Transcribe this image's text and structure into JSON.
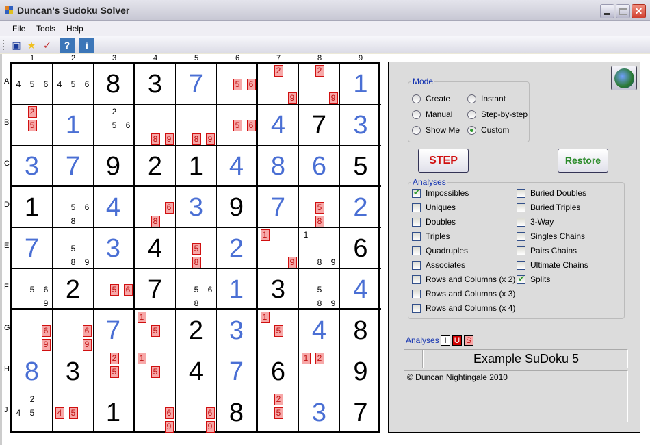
{
  "window": {
    "title": "Duncan's Sudoku Solver",
    "controls": [
      "minimize",
      "maximize",
      "close"
    ]
  },
  "menu": [
    "File",
    "Tools",
    "Help"
  ],
  "toolbar": [
    {
      "name": "save-icon",
      "glyph": "💾"
    },
    {
      "name": "star-icon",
      "glyph": "★"
    },
    {
      "name": "check-document-icon",
      "glyph": "✔"
    },
    {
      "name": "help-icon",
      "glyph": "?"
    },
    {
      "name": "info-icon",
      "glyph": "i"
    }
  ],
  "grid": {
    "columns": [
      "1",
      "2",
      "3",
      "4",
      "5",
      "6",
      "7",
      "8",
      "9"
    ],
    "rows": [
      "A",
      "B",
      "C",
      "D",
      "E",
      "F",
      "G",
      "H",
      "J"
    ],
    "colors": {
      "given": "#000000",
      "solved": "#4a6fd4",
      "impossible_bg": "#f7a8a8",
      "impossible_border": "#d01010"
    },
    "cells": [
      [
        {
          "c": [
            [
              4,
              "n"
            ],
            [
              5,
              "n"
            ],
            [
              6,
              "n"
            ]
          ]
        },
        {
          "c": [
            [
              4,
              "n"
            ],
            [
              5,
              "n"
            ],
            [
              6,
              "n"
            ]
          ]
        },
        {
          "v": 8,
          "t": "k"
        },
        {
          "v": 3,
          "t": "k"
        },
        {
          "v": 7,
          "t": "b"
        },
        {
          "c": [
            [
              5,
              "r"
            ],
            [
              6,
              "r"
            ]
          ]
        },
        {
          "c": [
            [
              2,
              "r"
            ],
            [
              9,
              "r"
            ]
          ]
        },
        {
          "c": [
            [
              2,
              "r"
            ],
            [
              9,
              "r"
            ]
          ]
        },
        {
          "v": 1,
          "t": "b"
        }
      ],
      [
        {
          "c": [
            [
              2,
              "r"
            ],
            [
              5,
              "r"
            ]
          ]
        },
        {
          "v": 1,
          "t": "b"
        },
        {
          "c": [
            [
              2,
              "n"
            ],
            [
              5,
              "n"
            ],
            [
              6,
              "n"
            ]
          ]
        },
        {
          "c": [
            [
              8,
              "r"
            ],
            [
              9,
              "r"
            ]
          ]
        },
        {
          "c": [
            [
              8,
              "r"
            ],
            [
              9,
              "r"
            ]
          ]
        },
        {
          "c": [
            [
              5,
              "r"
            ],
            [
              6,
              "r"
            ]
          ]
        },
        {
          "v": 4,
          "t": "b"
        },
        {
          "v": 7,
          "t": "k"
        },
        {
          "v": 3,
          "t": "b"
        }
      ],
      [
        {
          "v": 3,
          "t": "b"
        },
        {
          "v": 7,
          "t": "b"
        },
        {
          "v": 9,
          "t": "k"
        },
        {
          "v": 2,
          "t": "k"
        },
        {
          "v": 1,
          "t": "k"
        },
        {
          "v": 4,
          "t": "b"
        },
        {
          "v": 8,
          "t": "b"
        },
        {
          "v": 6,
          "t": "b"
        },
        {
          "v": 5,
          "t": "k"
        }
      ],
      [
        {
          "v": 1,
          "t": "k"
        },
        {
          "c": [
            [
              5,
              "n"
            ],
            [
              6,
              "n"
            ],
            [
              8,
              "n"
            ]
          ]
        },
        {
          "v": 4,
          "t": "b"
        },
        {
          "c": [
            [
              6,
              "r"
            ],
            [
              8,
              "r"
            ]
          ]
        },
        {
          "v": 3,
          "t": "b"
        },
        {
          "v": 9,
          "t": "k"
        },
        {
          "v": 7,
          "t": "b"
        },
        {
          "c": [
            [
              5,
              "r"
            ],
            [
              8,
              "r"
            ]
          ]
        },
        {
          "v": 2,
          "t": "b"
        }
      ],
      [
        {
          "v": 7,
          "t": "b"
        },
        {
          "c": [
            [
              5,
              "n"
            ],
            [
              8,
              "n"
            ],
            [
              9,
              "n"
            ]
          ]
        },
        {
          "v": 3,
          "t": "b"
        },
        {
          "v": 4,
          "t": "k"
        },
        {
          "c": [
            [
              5,
              "r"
            ],
            [
              8,
              "r"
            ]
          ]
        },
        {
          "v": 2,
          "t": "b"
        },
        {
          "c": [
            [
              1,
              "r"
            ],
            [
              9,
              "r"
            ]
          ]
        },
        {
          "c": [
            [
              1,
              "n"
            ],
            [
              8,
              "n"
            ],
            [
              9,
              "n"
            ]
          ]
        },
        {
          "v": 6,
          "t": "k"
        }
      ],
      [
        {
          "c": [
            [
              5,
              "n"
            ],
            [
              6,
              "n"
            ],
            [
              9,
              "n"
            ]
          ]
        },
        {
          "v": 2,
          "t": "k"
        },
        {
          "c": [
            [
              5,
              "r"
            ],
            [
              6,
              "r"
            ]
          ]
        },
        {
          "v": 7,
          "t": "k"
        },
        {
          "c": [
            [
              5,
              "n"
            ],
            [
              6,
              "n"
            ],
            [
              8,
              "n"
            ]
          ]
        },
        {
          "v": 1,
          "t": "b"
        },
        {
          "v": 3,
          "t": "k"
        },
        {
          "c": [
            [
              5,
              "n"
            ],
            [
              8,
              "n"
            ],
            [
              9,
              "n"
            ]
          ]
        },
        {
          "v": 4,
          "t": "b"
        }
      ],
      [
        {
          "c": [
            [
              6,
              "r"
            ],
            [
              9,
              "r"
            ]
          ]
        },
        {
          "c": [
            [
              6,
              "r"
            ],
            [
              9,
              "r"
            ]
          ]
        },
        {
          "v": 7,
          "t": "b"
        },
        {
          "c": [
            [
              1,
              "r"
            ],
            [
              5,
              "r"
            ]
          ]
        },
        {
          "v": 2,
          "t": "k"
        },
        {
          "v": 3,
          "t": "b"
        },
        {
          "c": [
            [
              1,
              "r"
            ],
            [
              5,
              "r"
            ]
          ]
        },
        {
          "v": 4,
          "t": "b"
        },
        {
          "v": 8,
          "t": "k"
        }
      ],
      [
        {
          "v": 8,
          "t": "b"
        },
        {
          "v": 3,
          "t": "k"
        },
        {
          "c": [
            [
              2,
              "r"
            ],
            [
              5,
              "r"
            ]
          ]
        },
        {
          "c": [
            [
              1,
              "r"
            ],
            [
              5,
              "r"
            ]
          ]
        },
        {
          "v": 4,
          "t": "k"
        },
        {
          "v": 7,
          "t": "b"
        },
        {
          "v": 6,
          "t": "k"
        },
        {
          "c": [
            [
              1,
              "r"
            ],
            [
              2,
              "r"
            ]
          ]
        },
        {
          "v": 9,
          "t": "k"
        }
      ],
      [
        {
          "c": [
            [
              2,
              "n"
            ],
            [
              4,
              "n"
            ],
            [
              5,
              "n"
            ]
          ]
        },
        {
          "c": [
            [
              4,
              "r"
            ],
            [
              5,
              "r"
            ]
          ]
        },
        {
          "v": 1,
          "t": "k"
        },
        {
          "c": [
            [
              6,
              "r"
            ],
            [
              9,
              "r"
            ]
          ]
        },
        {
          "c": [
            [
              6,
              "r"
            ],
            [
              9,
              "r"
            ]
          ]
        },
        {
          "v": 8,
          "t": "k"
        },
        {
          "c": [
            [
              2,
              "r"
            ],
            [
              5,
              "r"
            ]
          ]
        },
        {
          "v": 3,
          "t": "b"
        },
        {
          "v": 7,
          "t": "k"
        }
      ]
    ]
  },
  "panel": {
    "mode": {
      "legend": "Mode",
      "options": [
        {
          "label": "Create",
          "selected": false
        },
        {
          "label": "Instant",
          "selected": false
        },
        {
          "label": "Manual",
          "selected": false
        },
        {
          "label": "Step-by-step",
          "selected": false
        },
        {
          "label": "Show Me",
          "selected": false
        },
        {
          "label": "Custom",
          "selected": true
        }
      ]
    },
    "step_label": "STEP",
    "restore_label": "Restore",
    "step_color": "#d01010",
    "restore_color": "#2a8a2a",
    "analyses": {
      "legend": "Analyses",
      "left": [
        {
          "label": "Impossibles",
          "checked": true
        },
        {
          "label": "Uniques",
          "checked": false
        },
        {
          "label": "Doubles",
          "checked": false
        },
        {
          "label": "Triples",
          "checked": false
        },
        {
          "label": "Quadruples",
          "checked": false
        },
        {
          "label": "Associates",
          "checked": false
        },
        {
          "label": "Rows and Columns (x 2)",
          "checked": false
        },
        {
          "label": "Rows and Columns (x 3)",
          "checked": false
        },
        {
          "label": "Rows and Columns (x 4)",
          "checked": false
        }
      ],
      "right": [
        {
          "label": "Buried Doubles",
          "checked": false
        },
        {
          "label": "Buried Triples",
          "checked": false
        },
        {
          "label": "3-Way",
          "checked": false
        },
        {
          "label": "Singles Chains",
          "checked": false
        },
        {
          "label": "Pairs Chains",
          "checked": false
        },
        {
          "label": "Ultimate Chains",
          "checked": false
        },
        {
          "label": "Splits",
          "checked": true
        }
      ]
    },
    "indicator": {
      "label": "Analyses",
      "boxes": [
        {
          "text": "I",
          "bg": "#ffffff",
          "fg": "#000000"
        },
        {
          "text": "U",
          "bg": "#d00000",
          "fg": "#ffffff"
        },
        {
          "text": "S",
          "bg": "#f7a8a8",
          "fg": "#c01010"
        }
      ]
    },
    "puzzle_name": "Example SuDoku 5",
    "notes": "© Duncan Nightingale 2010"
  }
}
